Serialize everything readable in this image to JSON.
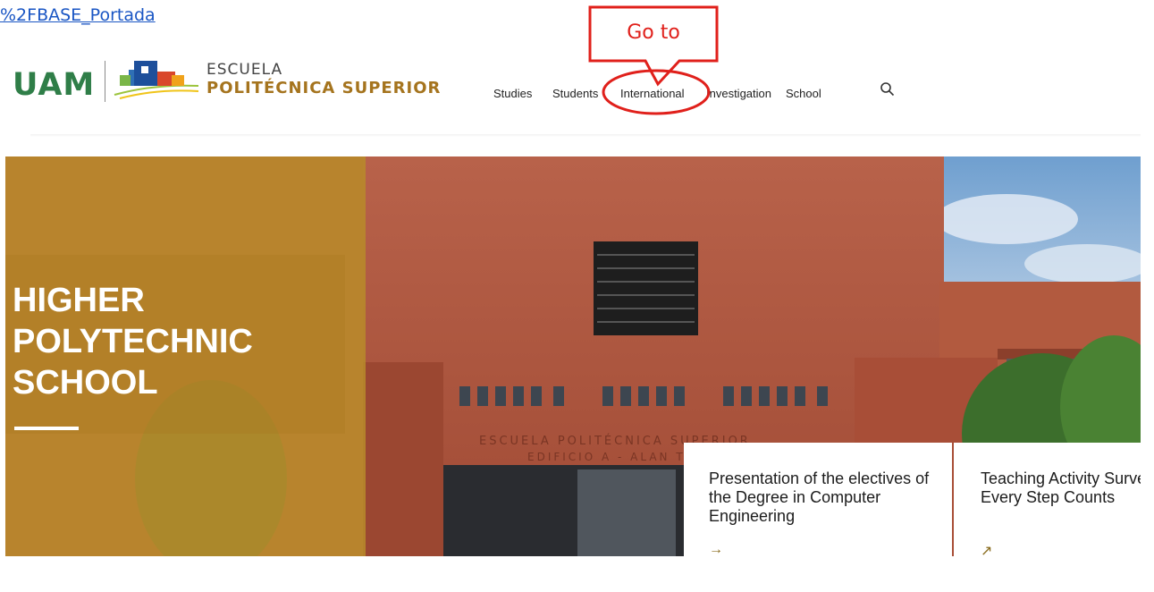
{
  "top_link": {
    "text": "%2FBASE_Portada"
  },
  "header": {
    "logo_uam": "UAM",
    "logo_line1": "ESCUELA",
    "logo_line2": "POLITÉCNICA SUPERIOR",
    "nav": [
      "Studies",
      "Students",
      "International",
      "Investigation",
      "School"
    ],
    "search_icon": "search-icon"
  },
  "annotation": {
    "label": "Go to",
    "target": "International",
    "color": "#e0201b"
  },
  "hero": {
    "title_lines": [
      "HIGHER",
      "POLYTECHNIC",
      "SCHOOL"
    ],
    "building_sign_line1": "ESCUELA POLITÉCNICA SUPERIOR",
    "building_sign_line2": "EDIFICIO A - ALAN TURING"
  },
  "cards": [
    {
      "title": "Presentation of the electives of the Degree in Computer Engineering",
      "arrow": "→",
      "arrow_icon": "arrow-right-icon"
    },
    {
      "title": "Teaching Activity Surveys. Every Step Counts",
      "arrow": "↗",
      "arrow_icon": "arrow-up-right-icon"
    }
  ],
  "colors": {
    "brand_green": "#2f7e48",
    "brand_gold": "#a5741e",
    "link_blue": "#1a56c4",
    "overlay_gold": "#b88a2a",
    "brick": "#b45b40"
  }
}
